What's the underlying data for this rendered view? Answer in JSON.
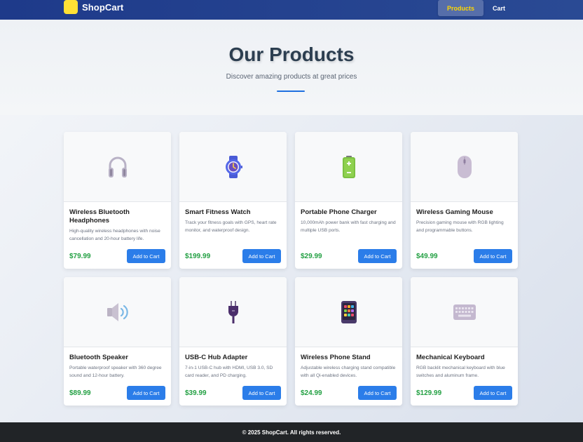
{
  "nav": {
    "brand": "ShopCart",
    "links": [
      {
        "label": "Products",
        "active": true
      },
      {
        "label": "Cart",
        "active": false
      }
    ]
  },
  "hero": {
    "title": "Our Products",
    "subtitle": "Discover amazing products at great prices"
  },
  "products": [
    {
      "name": "Wireless Bluetooth Headphones",
      "description": "High-quality wireless headphones with noise cancellation and 20-hour battery life.",
      "price": "$79.99",
      "button": "Add to Cart",
      "icon": "headphones-icon"
    },
    {
      "name": "Smart Fitness Watch",
      "description": "Track your fitness goals with GPS, heart rate monitor, and waterproof design.",
      "price": "$199.99",
      "button": "Add to Cart",
      "icon": "watch-icon"
    },
    {
      "name": "Portable Phone Charger",
      "description": "10,000mAh power bank with fast charging and multiple USB ports.",
      "price": "$29.99",
      "button": "Add to Cart",
      "icon": "battery-icon"
    },
    {
      "name": "Wireless Gaming Mouse",
      "description": "Precision gaming mouse with RGB lighting and programmable buttons.",
      "price": "$49.99",
      "button": "Add to Cart",
      "icon": "mouse-icon"
    },
    {
      "name": "Bluetooth Speaker",
      "description": "Portable waterproof speaker with 360 degree sound and 12-hour battery.",
      "price": "$89.99",
      "button": "Add to Cart",
      "icon": "speaker-icon"
    },
    {
      "name": "USB-C Hub Adapter",
      "description": "7-in-1 USB-C hub with HDMI, USB 3.0, SD card reader, and PD charging.",
      "price": "$39.99",
      "button": "Add to Cart",
      "icon": "plug-icon"
    },
    {
      "name": "Wireless Phone Stand",
      "description": "Adjustable wireless charging stand compatible with all Qi-enabled devices.",
      "price": "$24.99",
      "button": "Add to Cart",
      "icon": "phone-icon"
    },
    {
      "name": "Mechanical Keyboard",
      "description": "RGB backlit mechanical keyboard with blue switches and aluminum frame.",
      "price": "$129.99",
      "button": "Add to Cart",
      "icon": "keyboard-icon"
    }
  ],
  "footer": {
    "text": "© 2025 ShopCart. All rights reserved."
  },
  "colors": {
    "nav": "#1e3a8a",
    "accent": "#2b7de9",
    "price": "#23a043",
    "active_link": "#ffd700"
  }
}
